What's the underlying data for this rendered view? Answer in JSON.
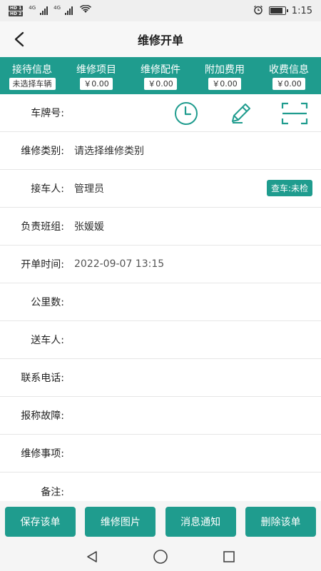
{
  "status_bar": {
    "hd_top": "HD 1",
    "hd_bottom": "HD 2",
    "net1": "4G",
    "net2": "4G",
    "time": "1:15"
  },
  "header": {
    "title": "维修开单"
  },
  "tabs": [
    {
      "label": "接待信息",
      "value": "未选择车辆"
    },
    {
      "label": "维修项目",
      "value": "￥0.00"
    },
    {
      "label": "维修配件",
      "value": "￥0.00"
    },
    {
      "label": "附加费用",
      "value": "￥0.00"
    },
    {
      "label": "收费信息",
      "value": "￥0.00"
    }
  ],
  "form": {
    "plate": {
      "label": "车牌号:",
      "value": ""
    },
    "repair_type": {
      "label": "维修类别:",
      "value": "请选择维修类别"
    },
    "receiver": {
      "label": "接车人:",
      "value": "管理员",
      "badge": "查车:未检"
    },
    "team": {
      "label": "负责班组:",
      "value": "张媛媛"
    },
    "open_time": {
      "label": "开单时间:",
      "value": "2022-09-07 13:15"
    },
    "mileage": {
      "label": "公里数:",
      "value": ""
    },
    "sender": {
      "label": "送车人:",
      "value": ""
    },
    "phone": {
      "label": "联系电话:",
      "value": ""
    },
    "fault": {
      "label": "报称故障:",
      "value": ""
    },
    "matters": {
      "label": "维修事项:",
      "value": ""
    },
    "remark": {
      "label": "备注:",
      "value": ""
    }
  },
  "actions": {
    "save": "保存该单",
    "photos": "维修图片",
    "notify": "消息通知",
    "delete": "删除该单"
  },
  "colors": {
    "accent": "#1f9c8e"
  }
}
